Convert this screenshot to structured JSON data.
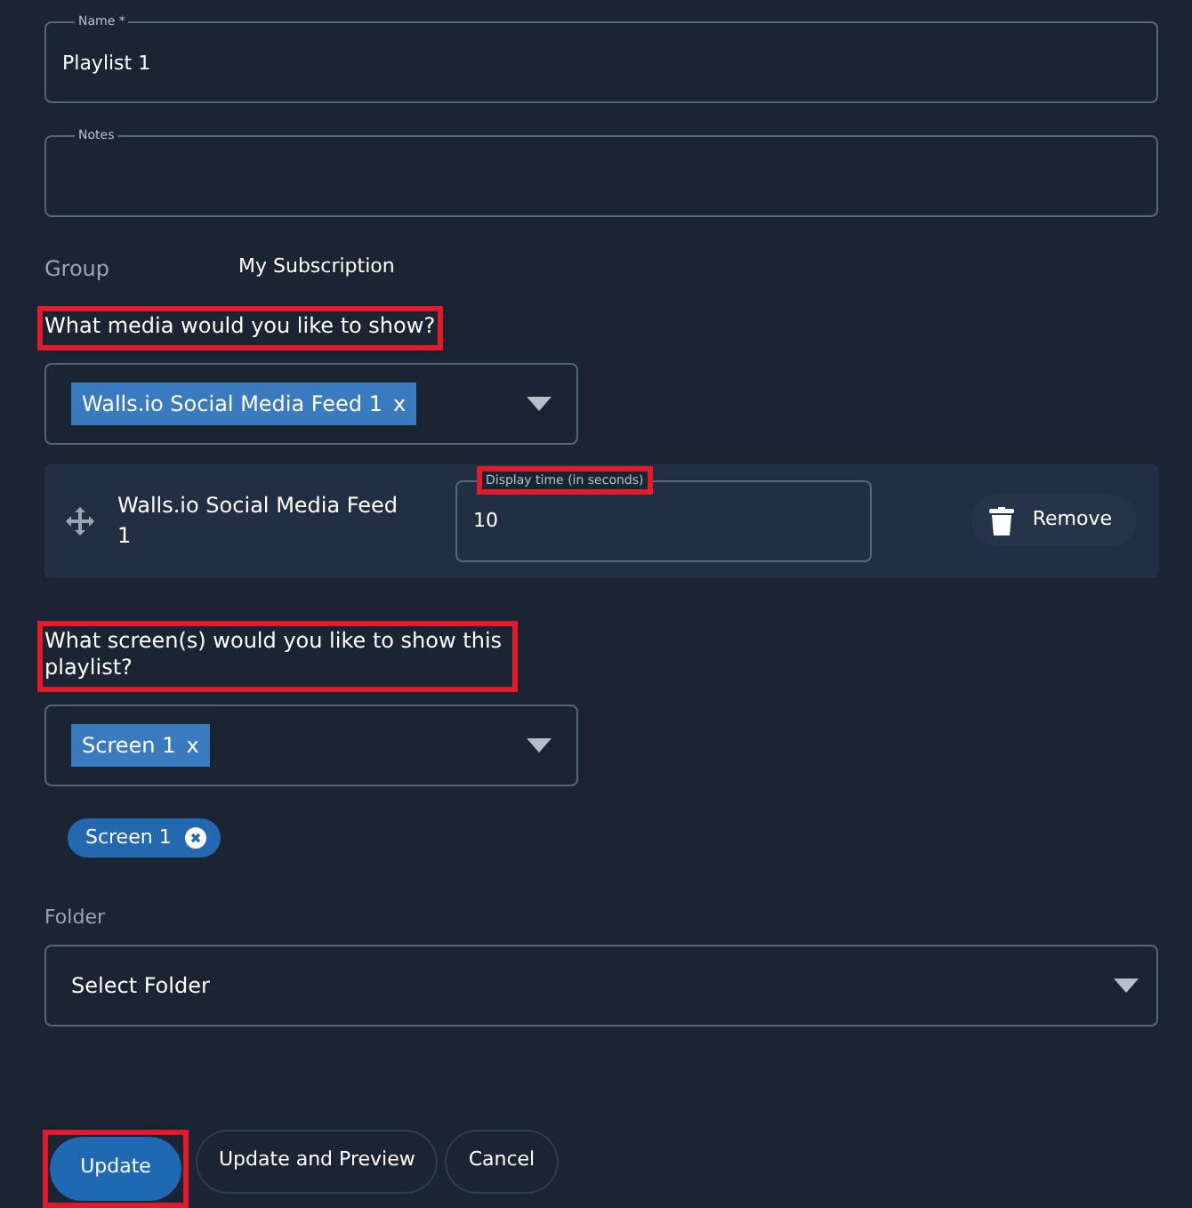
{
  "name_field": {
    "label": "Name *",
    "value": "Playlist 1"
  },
  "notes_field": {
    "label": "Notes"
  },
  "group": {
    "label": "Group",
    "value": "My Subscription"
  },
  "media_question": {
    "text": "What media would you like to show?",
    "highlighted": true
  },
  "media_select": {
    "tags": [
      {
        "label": "Walls.io Social Media Feed 1",
        "remove": "x"
      }
    ]
  },
  "media_items": [
    {
      "title": "Walls.io Social Media Feed 1",
      "display_time": {
        "label": "Display time (in seconds)",
        "value": "10",
        "highlighted": true
      },
      "remove_button": "Remove"
    }
  ],
  "screens_question": {
    "text": "What screen(s) would you like to show this playlist?",
    "highlighted": true
  },
  "screens_select": {
    "tags": [
      {
        "label": "Screen 1",
        "remove": "x"
      }
    ]
  },
  "screen_chips": [
    {
      "label": "Screen 1"
    }
  ],
  "folder": {
    "label": "Folder",
    "placeholder": "Select Folder"
  },
  "buttons": [
    {
      "label": "Update",
      "kind": "primary",
      "highlighted": true
    },
    {
      "label": "Update and Preview",
      "kind": "outline",
      "highlighted": false
    },
    {
      "label": "Cancel",
      "kind": "outline",
      "highlighted": false
    }
  ]
}
